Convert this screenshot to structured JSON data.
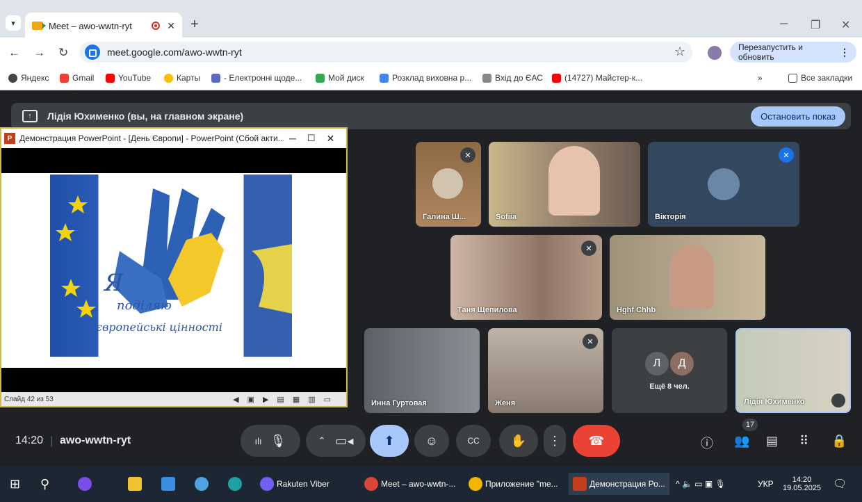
{
  "browser": {
    "tab_title": "Meet – awo-wwtn-ryt",
    "url": "meet.google.com/awo-wwtn-ryt",
    "relaunch_label": "Перезапустить и обновить",
    "bookmarks": [
      "Яндекс",
      "Gmail",
      "YouTube",
      "Карты",
      "- Електронні щоде...",
      "Мой диск",
      "Розклад виховна р...",
      "Вхід до ЄАС",
      "(14727) Майстер-к..."
    ],
    "all_bookmarks": "Все закладки"
  },
  "meet": {
    "presenting_text": "Лідія Юхименко (вы, на главном экране)",
    "stop_label": "Остановить показ",
    "participants": [
      {
        "name": "Галина Ш...",
        "muted": true
      },
      {
        "name": "Sofiia",
        "muted": false
      },
      {
        "name": "Вікторія",
        "muted": true
      },
      {
        "name": "Таня Щепилова",
        "muted": true
      },
      {
        "name": "Hghf Chhb",
        "muted": false
      },
      {
        "name": "Инна Гуртовая",
        "muted": false
      },
      {
        "name": "Женя",
        "muted": true
      },
      {
        "name": "Лідія Юхименко",
        "muted": false
      }
    ],
    "more_avatars": [
      "Л",
      "Д"
    ],
    "more_label": "Ещё 8 чел.",
    "time": "14:20",
    "meeting_code": "awo-wwtn-ryt",
    "people_count": "17"
  },
  "ppt": {
    "window_title": "Демонстрация PowerPoint - [День Європи] - PowerPoint (Сбой акти...",
    "slide_text_1": "Я",
    "slide_text_2": "поділяю",
    "slide_text_3": "європейські цінності",
    "status": "Слайд 42 из 53"
  },
  "taskbar": {
    "apps": [
      "Rakuten Viber",
      "Meet – awo-wwtn-...",
      "Приложение \"me...",
      "Демонстрация Ро..."
    ],
    "lang": "УКР",
    "clock_time": "14:20",
    "clock_date": "19.05.2025"
  }
}
